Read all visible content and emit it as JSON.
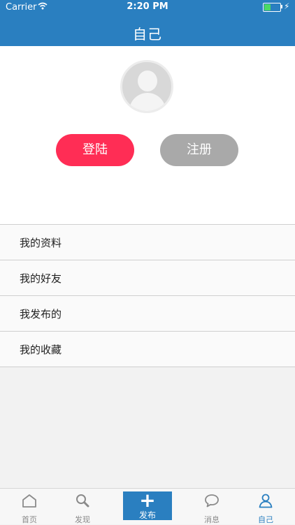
{
  "status_bar": {
    "carrier": "Carrier",
    "time": "2:20 PM",
    "battery_level": 0.35,
    "icons": [
      "wifi-icon",
      "battery-icon",
      "charging-bolt-icon"
    ]
  },
  "nav": {
    "title": "自己"
  },
  "profile": {
    "avatar_icon": "default-avatar-icon",
    "login_label": "登陆",
    "register_label": "注册"
  },
  "menu": {
    "items": [
      {
        "label": "我的资料"
      },
      {
        "label": "我的好友"
      },
      {
        "label": "我发布的"
      },
      {
        "label": "我的收藏"
      }
    ]
  },
  "tabbar": {
    "items": [
      {
        "label": "首页",
        "icon": "home-icon"
      },
      {
        "label": "发现",
        "icon": "search-icon"
      },
      {
        "label": "发布",
        "icon": "plus-icon"
      },
      {
        "label": "消息",
        "icon": "chat-bubble-icon"
      },
      {
        "label": "自己",
        "icon": "person-icon",
        "active": true
      }
    ]
  },
  "colors": {
    "brand_blue": "#2a7fc0",
    "login_red": "#ff2d55",
    "register_gray": "#a9a9a9"
  }
}
